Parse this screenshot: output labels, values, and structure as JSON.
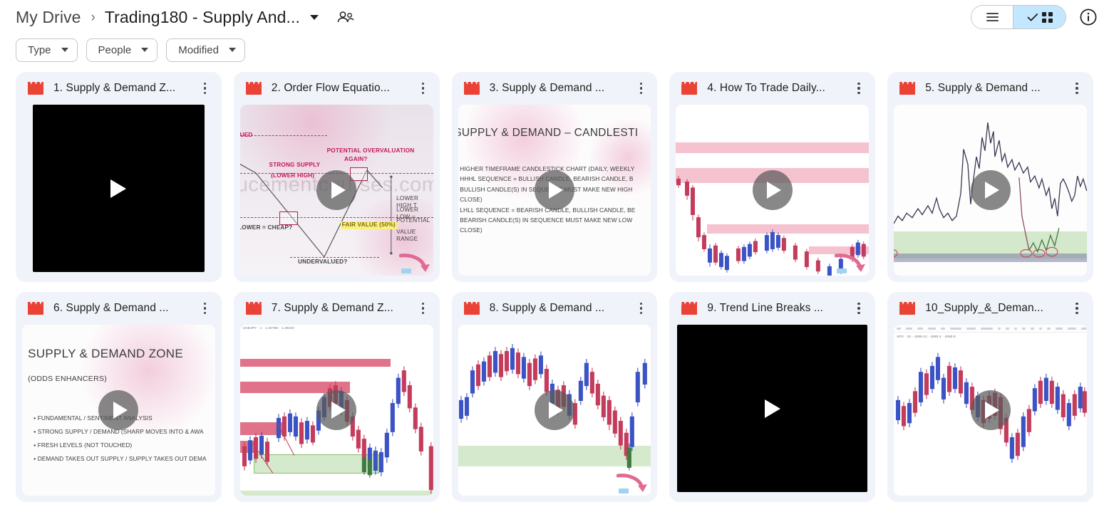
{
  "header": {
    "breadcrumb_root": "My Drive",
    "breadcrumb_separator": "›",
    "breadcrumb_current": "Trading180 - Supply And...",
    "people_icon": "people-icon",
    "caret_icon": "chevron-down-icon",
    "view_list_icon": "list-view-icon",
    "view_grid_icon": "grid-view-icon",
    "view_grid_check_icon": "check-icon",
    "info_icon": "info-icon",
    "accent_selected": "#c2e7ff",
    "border_color": "#c4c7c5"
  },
  "filters": [
    {
      "label": "Type",
      "icon": "chevron-down-icon"
    },
    {
      "label": "People",
      "icon": "chevron-down-icon"
    },
    {
      "label": "Modified",
      "icon": "chevron-down-icon"
    }
  ],
  "grid": {
    "file_icon": "video-clapperboard-icon",
    "file_icon_color": "#ea4335",
    "menu_icon": "more-vert-icon",
    "play_icon": "play-icon",
    "cards": [
      {
        "title": "1. Supply & Demand Z...",
        "thumb": "black"
      },
      {
        "title": "2. Order Flow Equatio...",
        "thumb": "zigzag-diagram"
      },
      {
        "title": "3. Supply & Demand ...",
        "thumb": "text-slide-candlestick"
      },
      {
        "title": "4. How To Trade Daily...",
        "thumb": "chart-supply-zones"
      },
      {
        "title": "5. Supply & Demand ...",
        "thumb": "chart-demand-green"
      },
      {
        "title": "6. Supply & Demand ...",
        "thumb": "text-slide-zone"
      },
      {
        "title": "7. Supply & Demand Z...",
        "thumb": "chart-multi-zones"
      },
      {
        "title": "8. Supply & Demand ...",
        "thumb": "chart-green-band"
      },
      {
        "title": "9. Trend Line Breaks ...",
        "thumb": "black"
      },
      {
        "title": "10_Supply_&_Deman...",
        "thumb": "chart-toolbar"
      }
    ]
  },
  "thumbnails": {
    "card2": {
      "watermark": "ducementcourses.com",
      "label_overvalued": "POTENTIAL OVERVALUATION",
      "label_overvalued2": "AGAIN?",
      "label_strong_supply": "STRONG SUPPLY",
      "label_strong_supply2": "(LOWER HIGH)",
      "label_lued": "LUED",
      "label_cheap": "LOWER = CHEAP?",
      "label_fair_value": "FAIR VALUE (50%)",
      "label_undervalued": "UNDERVALUED?",
      "label_range1": "LOWER HIGH T",
      "label_range2": "LOWER LOW =",
      "label_range3": "POTENTIAL",
      "label_range4": "VALUE RANGE"
    },
    "card3": {
      "title": "SUPPLY & DEMAND – CANDLESTI",
      "line1": "HIGHER TIMEFRAME CANDLESTICK CHART (DAILY, WEEKLY",
      "line2": "HHHL SEQUENCE = BULLISH CANDLE, BEARISH CANDLE, B",
      "line3": "BULLISH CANDLE(S) IN SEQUENCE MUST MAKE NEW HIGH",
      "line4": "CLOSE)",
      "line5": "LHLL SEQUENCE = BEARISH CANDLE, BULLISH CANDLE, BE",
      "line6": "BEARISH CANDLE(S) IN SEQUENCE MUST MAKE NEW LOW",
      "line7": "CLOSE)"
    },
    "card6": {
      "title": "SUPPLY & DEMAND ZONE",
      "subtitle": "(ODDS ENHANCERS)",
      "bullet1": "FUNDAMENTAL / SENTIMENT ANALYSIS",
      "bullet2": "STRONG SUPPLY / DEMAND (SHARP MOVES INTO & AWA",
      "bullet3": "FRESH LEVELS (NOT TOUCHED)",
      "bullet4": "DEMAND TAKES OUT SUPPLY / SUPPLY TAKES OUT DEMA"
    },
    "card7": {
      "ticker": "USDJPY · 1 · 1.32788 · 1.29102"
    },
    "card10": {
      "ticker": "SPX · 15 · 4089.12 · 4080.4 · 4090.8"
    }
  }
}
